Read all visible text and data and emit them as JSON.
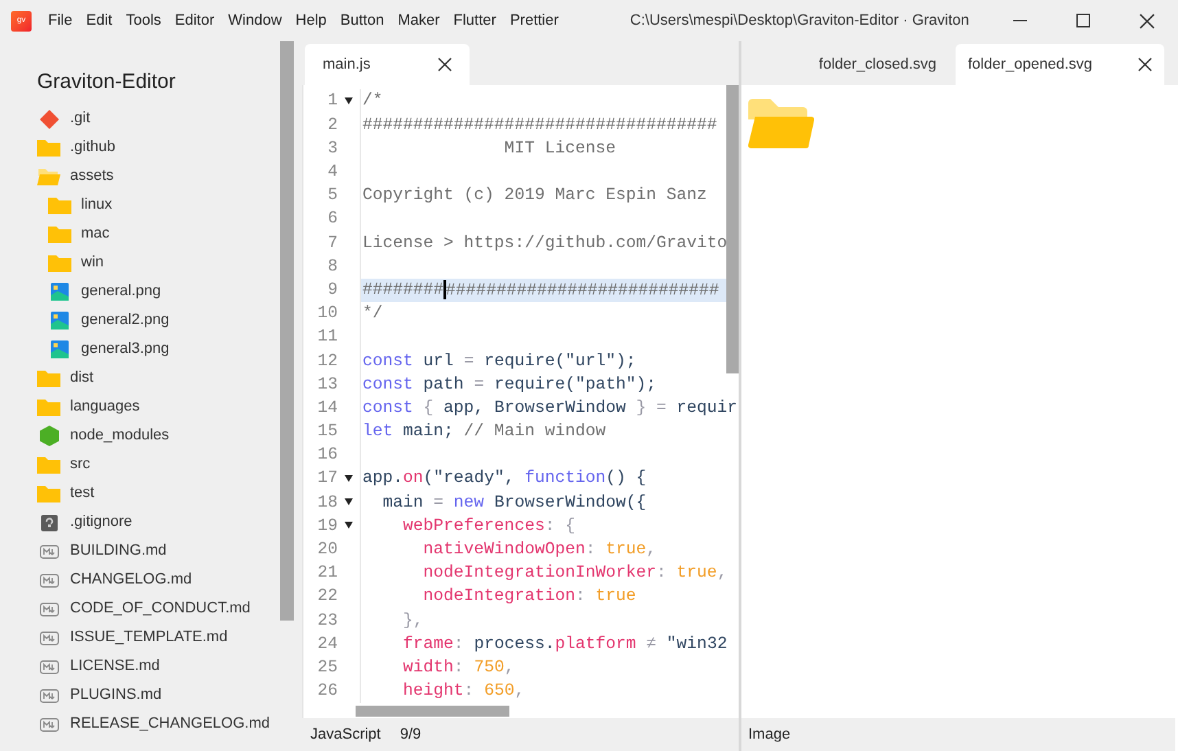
{
  "window": {
    "logo": "gv",
    "title": "C:\\Users\\mespi\\Desktop\\Graviton-Editor · Graviton"
  },
  "menu": [
    "File",
    "Edit",
    "Tools",
    "Editor",
    "Window",
    "Help",
    "Button",
    "Maker",
    "Flutter",
    "Prettier"
  ],
  "sidebar": {
    "title": "Graviton-Editor",
    "items": [
      {
        "kind": "git",
        "label": ".git"
      },
      {
        "kind": "folder",
        "label": ".github",
        "expanded": false
      },
      {
        "kind": "folder",
        "label": "assets",
        "expanded": true,
        "children": [
          {
            "kind": "folder",
            "label": "linux",
            "expanded": false
          },
          {
            "kind": "folder",
            "label": "mac",
            "expanded": false
          },
          {
            "kind": "folder",
            "label": "win",
            "expanded": false
          },
          {
            "kind": "image",
            "label": "general.png"
          },
          {
            "kind": "image",
            "label": "general2.png"
          },
          {
            "kind": "image",
            "label": "general3.png"
          }
        ]
      },
      {
        "kind": "folder",
        "label": "dist",
        "expanded": false
      },
      {
        "kind": "folder",
        "label": "languages",
        "expanded": false
      },
      {
        "kind": "node",
        "label": "node_modules"
      },
      {
        "kind": "folder",
        "label": "src",
        "expanded": false
      },
      {
        "kind": "folder",
        "label": "test",
        "expanded": false
      },
      {
        "kind": "unknown",
        "label": ".gitignore"
      },
      {
        "kind": "markdown",
        "label": "BUILDING.md"
      },
      {
        "kind": "markdown",
        "label": "CHANGELOG.md"
      },
      {
        "kind": "markdown",
        "label": "CODE_OF_CONDUCT.md"
      },
      {
        "kind": "markdown",
        "label": "ISSUE_TEMPLATE.md"
      },
      {
        "kind": "markdown",
        "label": "LICENSE.md"
      },
      {
        "kind": "markdown",
        "label": "PLUGINS.md"
      },
      {
        "kind": "markdown",
        "label": "RELEASE_CHANGELOG.md"
      }
    ]
  },
  "editor": {
    "tabs": [
      {
        "label": "main.js",
        "selected": true
      }
    ],
    "lines": [
      {
        "number": "1",
        "foldable": true,
        "active": false,
        "tokens": [
          {
            "kind": "comment",
            "text": "/*"
          }
        ]
      },
      {
        "number": "2",
        "foldable": false,
        "active": false,
        "tokens": [
          {
            "kind": "comment",
            "text": "###################################"
          }
        ]
      },
      {
        "number": "3",
        "foldable": false,
        "active": false,
        "tokens": [
          {
            "kind": "comment",
            "text": "              MIT License"
          }
        ]
      },
      {
        "number": "4",
        "foldable": false,
        "active": false
      },
      {
        "number": "5",
        "foldable": false,
        "active": false,
        "tokens": [
          {
            "kind": "comment",
            "text": "Copyright (c) 2019 Marc Espin Sanz"
          }
        ]
      },
      {
        "number": "6",
        "foldable": false,
        "active": false
      },
      {
        "number": "7",
        "foldable": false,
        "active": false,
        "tokens": [
          {
            "kind": "comment",
            "text": "License > https://github.com/Gravito"
          }
        ]
      },
      {
        "number": "8",
        "foldable": false,
        "active": false
      },
      {
        "number": "9",
        "foldable": false,
        "active": true,
        "tokens": [
          {
            "kind": "comment",
            "text": "########"
          },
          {
            "kind": "comment",
            "text": "###########################"
          }
        ]
      },
      {
        "number": "10",
        "foldable": false,
        "active": false,
        "tokens": [
          {
            "kind": "comment",
            "text": "*/"
          }
        ]
      },
      {
        "number": "11",
        "foldable": false,
        "active": false
      },
      {
        "number": "12",
        "foldable": false,
        "active": false,
        "tokens": [
          {
            "kind": "keyword",
            "text": "const"
          },
          {
            "kind": "plain",
            "text": " url "
          },
          {
            "kind": "punct",
            "text": "="
          },
          {
            "kind": "plain",
            "text": " require(\"url\");"
          }
        ]
      },
      {
        "number": "13",
        "foldable": false,
        "active": false,
        "tokens": [
          {
            "kind": "keyword",
            "text": "const"
          },
          {
            "kind": "plain",
            "text": " path "
          },
          {
            "kind": "punct",
            "text": "="
          },
          {
            "kind": "plain",
            "text": " require(\"path\");"
          }
        ]
      },
      {
        "number": "14",
        "foldable": false,
        "active": false,
        "tokens": [
          {
            "kind": "keyword",
            "text": "const"
          },
          {
            "kind": "punct",
            "text": " { "
          },
          {
            "kind": "plain",
            "text": "app, BrowserWindow"
          },
          {
            "kind": "punct",
            "text": " } = "
          },
          {
            "kind": "plain",
            "text": "requir"
          }
        ]
      },
      {
        "number": "15",
        "foldable": false,
        "active": false,
        "tokens": [
          {
            "kind": "keyword",
            "text": "let"
          },
          {
            "kind": "plain",
            "text": " main; "
          },
          {
            "kind": "comment",
            "text": "// Main window"
          }
        ]
      },
      {
        "number": "16",
        "foldable": false,
        "active": false
      },
      {
        "number": "17",
        "foldable": true,
        "active": false,
        "tokens": [
          {
            "kind": "plain",
            "text": "app."
          },
          {
            "kind": "property",
            "text": "on"
          },
          {
            "kind": "plain",
            "text": "(\"ready\", "
          },
          {
            "kind": "keyword",
            "text": "function"
          },
          {
            "kind": "plain",
            "text": "() {"
          }
        ]
      },
      {
        "number": "18",
        "foldable": true,
        "active": false,
        "tokens": [
          {
            "kind": "plain",
            "text": "  main "
          },
          {
            "kind": "punct",
            "text": "="
          },
          {
            "kind": "keyword",
            "text": " new"
          },
          {
            "kind": "plain",
            "text": " BrowserWindow({"
          }
        ]
      },
      {
        "number": "19",
        "foldable": true,
        "active": false,
        "tokens": [
          {
            "kind": "property",
            "text": "    webPreferences"
          },
          {
            "kind": "punct",
            "text": ": {"
          }
        ]
      },
      {
        "number": "20",
        "foldable": false,
        "active": false,
        "tokens": [
          {
            "kind": "property",
            "text": "      nativeWindowOpen"
          },
          {
            "kind": "punct",
            "text": ": "
          },
          {
            "kind": "literal",
            "text": "true"
          },
          {
            "kind": "punct",
            "text": ","
          }
        ]
      },
      {
        "number": "21",
        "foldable": false,
        "active": false,
        "tokens": [
          {
            "kind": "property",
            "text": "      nodeIntegrationInWorker"
          },
          {
            "kind": "punct",
            "text": ": "
          },
          {
            "kind": "literal",
            "text": "true"
          },
          {
            "kind": "punct",
            "text": ","
          }
        ]
      },
      {
        "number": "22",
        "foldable": false,
        "active": false,
        "tokens": [
          {
            "kind": "property",
            "text": "      nodeIntegration"
          },
          {
            "kind": "punct",
            "text": ": "
          },
          {
            "kind": "literal",
            "text": "true"
          }
        ]
      },
      {
        "number": "23",
        "foldable": false,
        "active": false,
        "tokens": [
          {
            "kind": "punct",
            "text": "    },"
          }
        ]
      },
      {
        "number": "24",
        "foldable": false,
        "active": false,
        "tokens": [
          {
            "kind": "property",
            "text": "    frame"
          },
          {
            "kind": "punct",
            "text": ": "
          },
          {
            "kind": "plain",
            "text": "process."
          },
          {
            "kind": "property",
            "text": "platform"
          },
          {
            "kind": "punct",
            "text": " ≠ "
          },
          {
            "kind": "plain",
            "text": "\"win32"
          }
        ]
      },
      {
        "number": "25",
        "foldable": false,
        "active": false,
        "tokens": [
          {
            "kind": "property",
            "text": "    width"
          },
          {
            "kind": "punct",
            "text": ": "
          },
          {
            "kind": "literal",
            "text": "750"
          },
          {
            "kind": "punct",
            "text": ","
          }
        ]
      },
      {
        "number": "26",
        "foldable": false,
        "active": false,
        "tokens": [
          {
            "kind": "property",
            "text": "    height"
          },
          {
            "kind": "punct",
            "text": ": "
          },
          {
            "kind": "literal",
            "text": "650"
          },
          {
            "kind": "punct",
            "text": ","
          }
        ]
      }
    ],
    "status": {
      "language": "JavaScript",
      "position": "9/9"
    }
  },
  "preview": {
    "tabs": [
      {
        "label": "folder_closed.svg",
        "selected": false
      },
      {
        "label": "folder_opened.svg",
        "selected": true
      }
    ],
    "status": "Image"
  }
}
